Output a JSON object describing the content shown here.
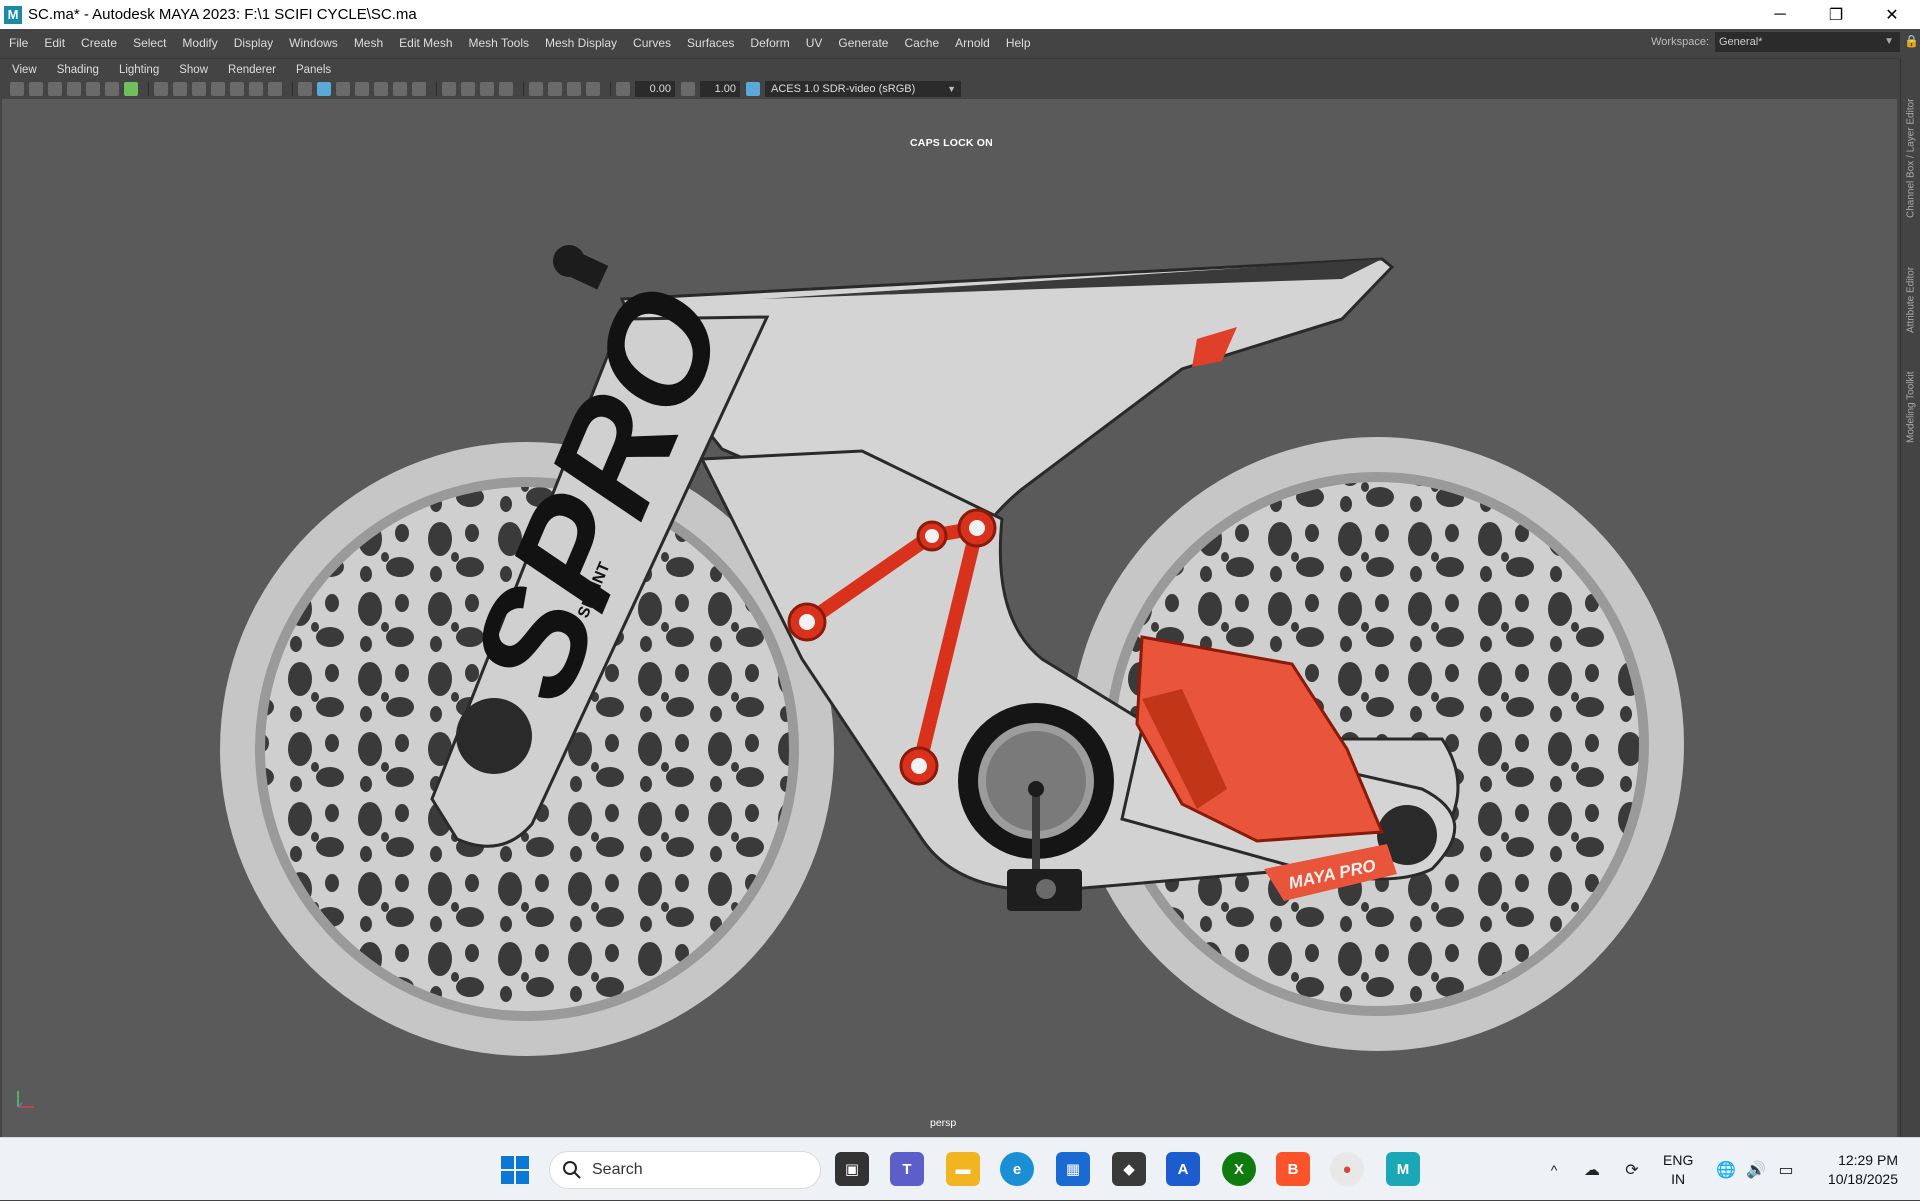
{
  "window": {
    "title": "SC.ma* - Autodesk MAYA 2023: F:\\1 SCIFI CYCLE\\SC.ma",
    "app_icon_letter": "M",
    "minimize_glyph": "─",
    "maximize_glyph": "❐",
    "close_glyph": "✕"
  },
  "menubar": {
    "items": [
      "File",
      "Edit",
      "Create",
      "Select",
      "Modify",
      "Display",
      "Windows",
      "Mesh",
      "Edit Mesh",
      "Mesh Tools",
      "Mesh Display",
      "Curves",
      "Surfaces",
      "Deform",
      "UV",
      "Generate",
      "Cache",
      "Arnold",
      "Help"
    ],
    "workspace_label": "Workspace:",
    "workspace_value": "General*"
  },
  "panel_menu": {
    "items": [
      "View",
      "Shading",
      "Lighting",
      "Show",
      "Renderer",
      "Panels"
    ]
  },
  "viewport_toolbar": {
    "exposure": "0.00",
    "gamma": "1.00",
    "color_space": "ACES 1.0 SDR-video (sRGB)"
  },
  "viewport": {
    "hud_message": "CAPS LOCK ON",
    "camera_name": "persp",
    "model_logo_main": "SPRO",
    "model_logo_small": "SPRINT",
    "model_badge": "MAYA PRO",
    "colors": {
      "background": "#5a5a5a",
      "body": "#cfcfcf",
      "accent": "#e0402a",
      "dark": "#1c1c1c"
    }
  },
  "right_tabs": [
    "Channel Box / Layer Editor",
    "Attribute Editor",
    "Modeling Toolkit"
  ],
  "taskbar": {
    "search_label": "Search",
    "apps": [
      "file-explorer",
      "teams",
      "files",
      "edge",
      "store",
      "unity",
      "autodesk",
      "xbox",
      "brave",
      "chrome",
      "maya"
    ],
    "language": [
      "ENG",
      "IN"
    ],
    "time": "12:29 PM",
    "date": "10/18/2025"
  }
}
